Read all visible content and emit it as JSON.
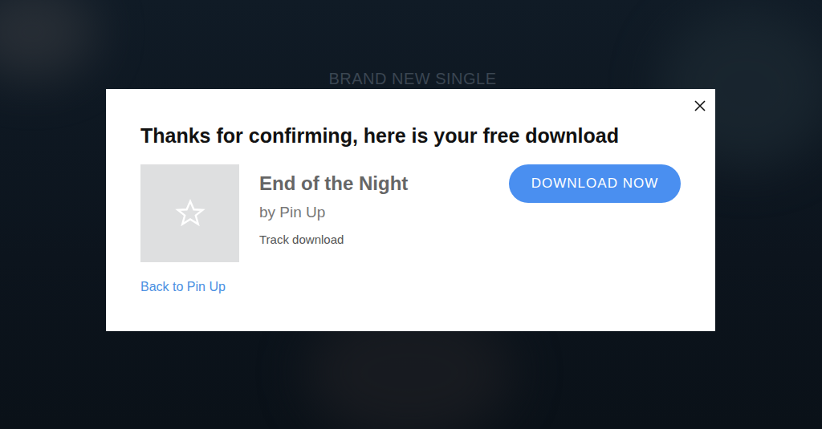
{
  "page": {
    "heading": "BRAND NEW SINGLE"
  },
  "modal": {
    "title": "Thanks for confirming, here is your free download",
    "track": {
      "title": "End of the Night",
      "artist": "by Pin Up",
      "type": "Track download"
    },
    "button": "DOWNLOAD NOW",
    "back_link": "Back to Pin Up"
  }
}
